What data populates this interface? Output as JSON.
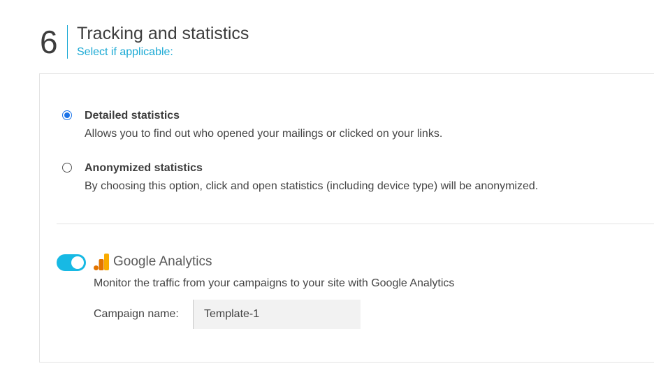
{
  "section": {
    "number": "6",
    "title": "Tracking and statistics",
    "subtitle": "Select if applicable:"
  },
  "statistics_options": [
    {
      "title": "Detailed statistics",
      "description": "Allows you to find out who opened your mailings or clicked on your links.",
      "selected": true
    },
    {
      "title": "Anonymized statistics",
      "description": "By choosing this option, click and open statistics (including device type) will be anonymized.",
      "selected": false
    }
  ],
  "google_analytics": {
    "enabled": true,
    "logo_icon": "google-analytics-logo-icon",
    "name": "Google Analytics",
    "description": "Monitor the traffic from your campaigns to your site with Google Analytics",
    "campaign_label": "Campaign name:",
    "campaign_value": "Template-1"
  },
  "colors": {
    "accent": "#1aa9d4",
    "toggle_on": "#17b9e4",
    "radio_selected": "#1a73e8",
    "ga_orange": "#f9ab00",
    "ga_dark_orange": "#e37400"
  }
}
